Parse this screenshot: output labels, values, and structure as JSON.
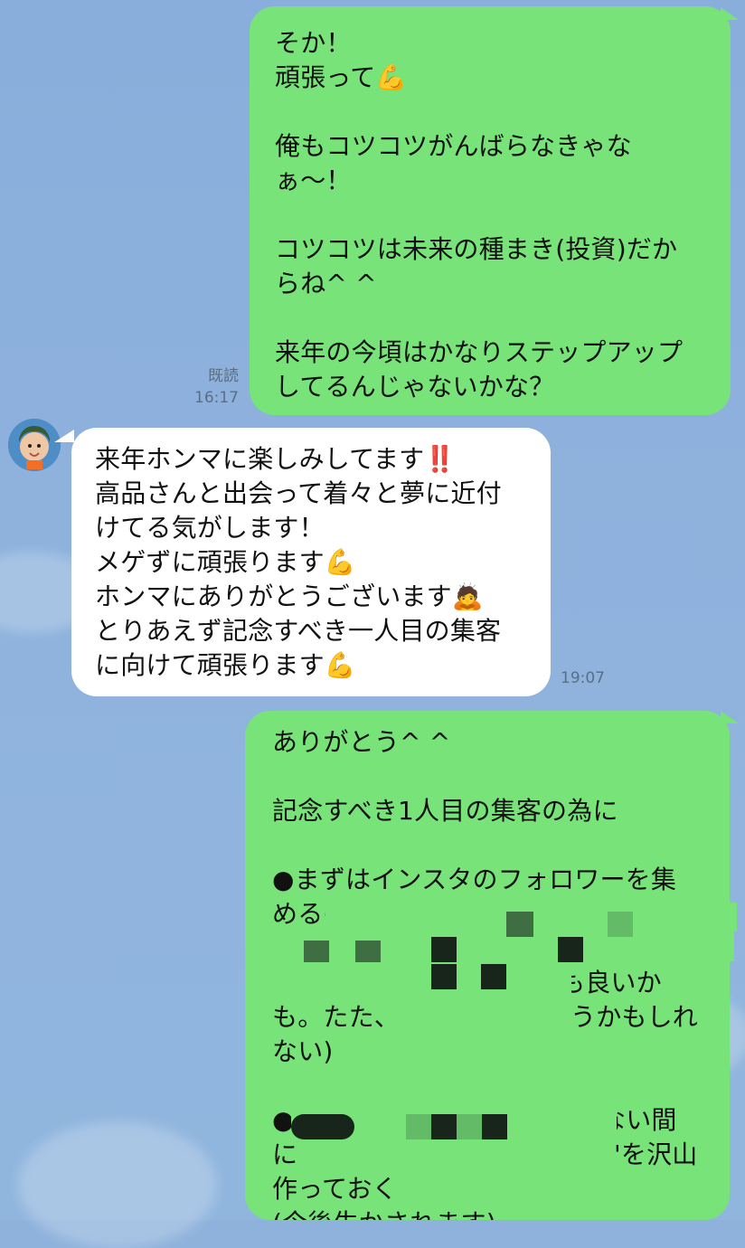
{
  "messages": [
    {
      "id": "msg1",
      "side": "right",
      "read_label": "既読",
      "time": "16:17",
      "lines": [
        "そか！",
        "頑張って💪",
        "",
        "俺もコツコツがんばらなきゃな",
        "ぁ〜！",
        "",
        "コツコツは未来の種まき(投資)だか",
        "らね^ ^",
        "",
        "来年の今頃はかなりステップアップ",
        "してるんじゃないかな？"
      ]
    },
    {
      "id": "msg2",
      "side": "left",
      "time": "19:07",
      "lines": [
        "来年ホンマに楽しみしてます‼️",
        "高品さんと出会って着々と夢に近付",
        "けてる気がします！",
        "メゲずに頑張ります💪",
        "ホンマにありがとうございます🙇",
        "とりあえず記念すべき一人目の集客",
        "に向けて頑張ります💪"
      ]
    },
    {
      "id": "msg3",
      "side": "right",
      "lines": [
        "ありがとう^ ^",
        "",
        "記念すべき1人目の集客の為に",
        "",
        "●まずはインスタのフォロワーを集",
        "める(",
        "",
        "も良いか",
        "も。たた、",
        "うかもしれ",
        "ない)",
        "",
        "●ラインのフォロワー数が少ない間",
        "に",
        "'を沢山",
        "作っておく",
        "(今後生かされます)"
      ]
    }
  ],
  "colors": {
    "background": "#8fb2dc",
    "outgoing_bubble": "#78e378",
    "incoming_bubble": "#ffffff",
    "meta_text": "#5a6f86"
  },
  "icons": {
    "avatar": "avatar-icon",
    "flexed_biceps": "flexed-biceps-icon",
    "double_exclamation": "double-exclamation-icon",
    "bowing_person": "bowing-person-icon"
  }
}
